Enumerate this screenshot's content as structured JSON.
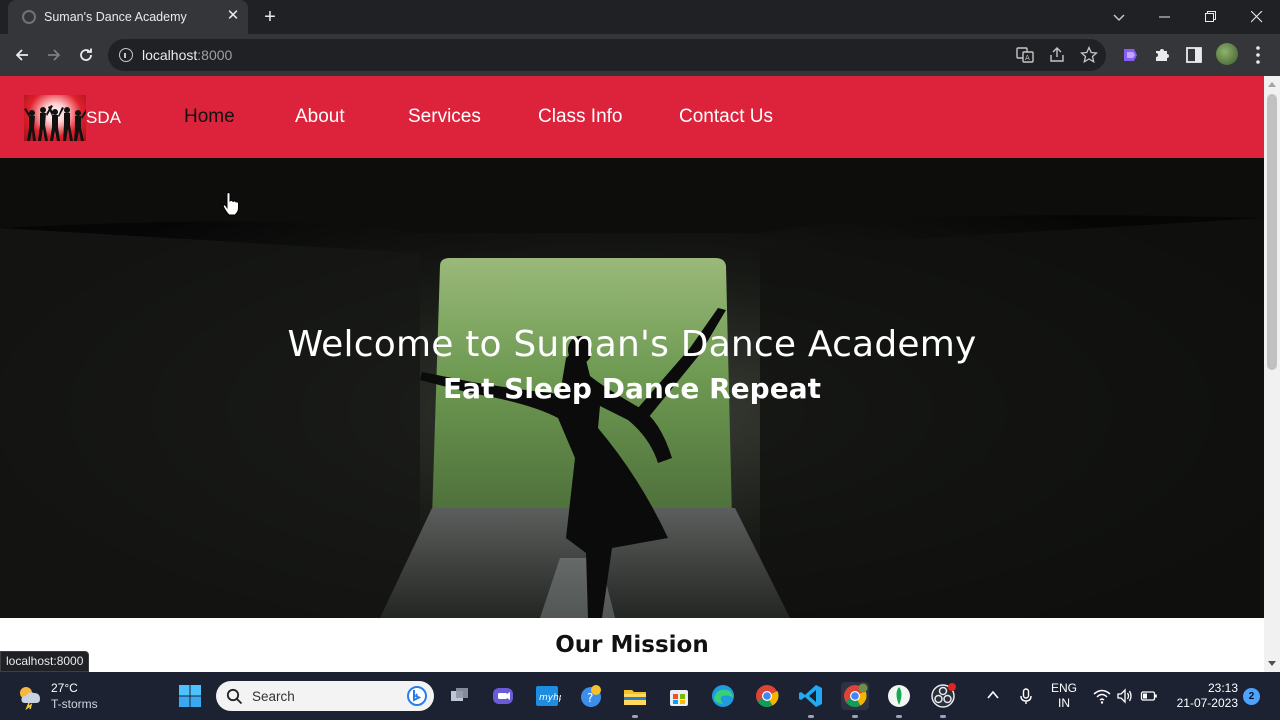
{
  "browser": {
    "tab_title": "Suman's Dance Academy",
    "url_host": "localhost",
    "url_port": ":8000",
    "status_url": "localhost:8000",
    "accent": "#dd233b"
  },
  "site": {
    "brand": "SDA",
    "nav": [
      {
        "label": "Home",
        "active": true
      },
      {
        "label": "About"
      },
      {
        "label": "Services"
      },
      {
        "label": "Class Info"
      },
      {
        "label": "Contact Us"
      }
    ],
    "hero_title": "Welcome to Suman's Dance Academy",
    "hero_subtitle": "Eat Sleep Dance Repeat",
    "section_title": "Our Mission"
  },
  "taskbar": {
    "weather_temp": "27°C",
    "weather_desc": "T-storms",
    "search_placeholder": "Search",
    "lang_top": "ENG",
    "lang_bottom": "IN",
    "time": "23:13",
    "date": "21-07-2023",
    "notification_count": "2"
  }
}
